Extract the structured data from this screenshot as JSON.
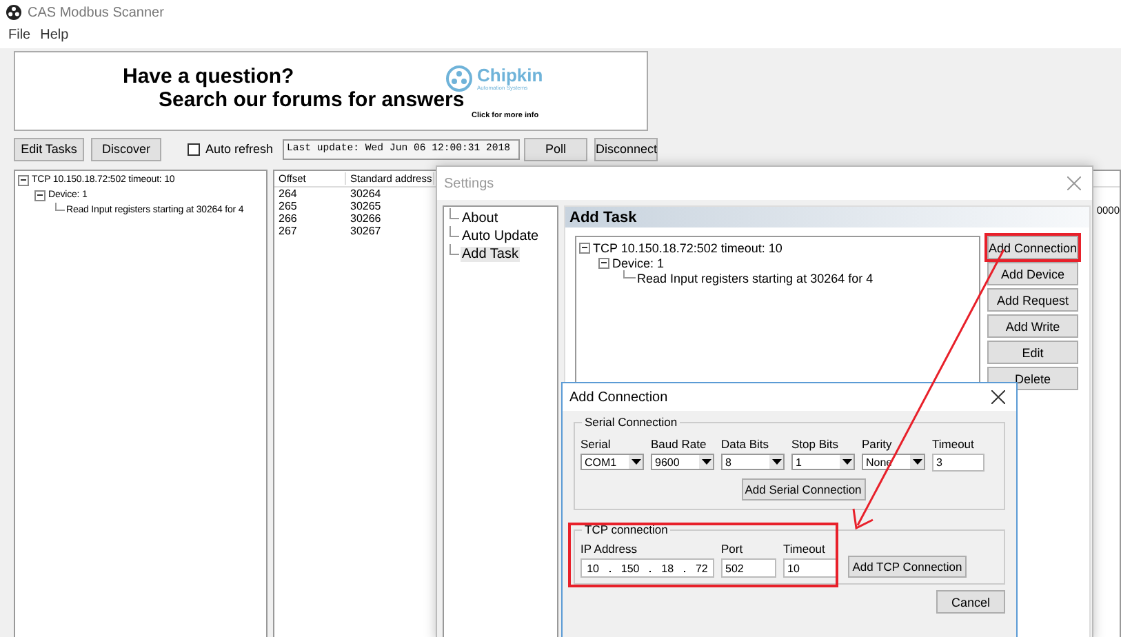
{
  "app": {
    "title": "CAS Modbus Scanner",
    "menu": [
      "File",
      "Help"
    ],
    "banner": {
      "heading": "Have a question?",
      "subheading": "Search our forums for answers",
      "logo_name": "Chipkin",
      "logo_tagline": "Automation Systems",
      "link": "Click for more info"
    },
    "toolbar": {
      "buttons": [
        "Edit Tasks",
        "Discover"
      ],
      "auto_refresh": {
        "label": "Auto refresh",
        "checked": false
      },
      "last_update": "Last update: Wed Jun 06 12:00:31 2018",
      "right_buttons": [
        "Poll",
        "Disconnect"
      ]
    },
    "task_tree": [
      {
        "label": "TCP 10.150.18.72:502 timeout: 10",
        "expanded": true,
        "children": [
          {
            "label": "Device: 1",
            "expanded": true,
            "children": [
              {
                "label": "Read Input registers starting at 30264 for 4"
              }
            ]
          }
        ]
      }
    ],
    "table": {
      "columns": [
        "Offset",
        "Standard address"
      ],
      "rows": [
        [
          "264",
          "30264"
        ],
        [
          "265",
          "30265"
        ],
        [
          "266",
          "30266"
        ],
        [
          "267",
          "30267"
        ]
      ],
      "column_3": "0000"
    }
  },
  "settings": {
    "title": "Settings",
    "nav": [
      {
        "label": "About",
        "selected": false
      },
      {
        "label": "Auto Update",
        "selected": false
      },
      {
        "label": "Add Task",
        "selected": true
      }
    ],
    "panel_title": "Add Task",
    "task_tree": [
      {
        "label": "TCP 10.150.18.72:502 timeout: 10",
        "expanded": true,
        "children": [
          {
            "label": "Device: 1",
            "expanded": true,
            "children": [
              {
                "label": "Read Input registers starting at 30264 for 4"
              }
            ]
          }
        ]
      }
    ],
    "buttons": [
      {
        "label": "Add Connection",
        "highlighted": true
      },
      {
        "label": "Add Device",
        "highlighted": false
      },
      {
        "label": "Add Request",
        "highlighted": false
      },
      {
        "label": "Add Write",
        "highlighted": false
      },
      {
        "label": "Edit",
        "highlighted": false
      },
      {
        "label": "Delete",
        "highlighted": false
      }
    ]
  },
  "add_connection": {
    "title": "Add Connection",
    "serial": {
      "legend": "Serial Connection",
      "fields": [
        {
          "label": "Serial",
          "value": "COM1",
          "kind": "select"
        },
        {
          "label": "Baud Rate",
          "value": "9600",
          "kind": "select"
        },
        {
          "label": "Data Bits",
          "value": "8",
          "kind": "select"
        },
        {
          "label": "Stop Bits",
          "value": "1",
          "kind": "select"
        },
        {
          "label": "Parity",
          "value": "None",
          "kind": "select"
        },
        {
          "label": "Timeout",
          "value": "3",
          "kind": "text"
        }
      ],
      "button": "Add Serial Connection"
    },
    "tcp": {
      "legend": "TCP connection",
      "highlighted": true,
      "ip_label": "IP Address",
      "ip_octets": [
        "10",
        "150",
        "18",
        "72"
      ],
      "fields": [
        {
          "label": "Port",
          "value": "502"
        },
        {
          "label": "Timeout",
          "value": "10"
        }
      ],
      "button": "Add TCP Connection"
    },
    "cancel": "Cancel"
  }
}
